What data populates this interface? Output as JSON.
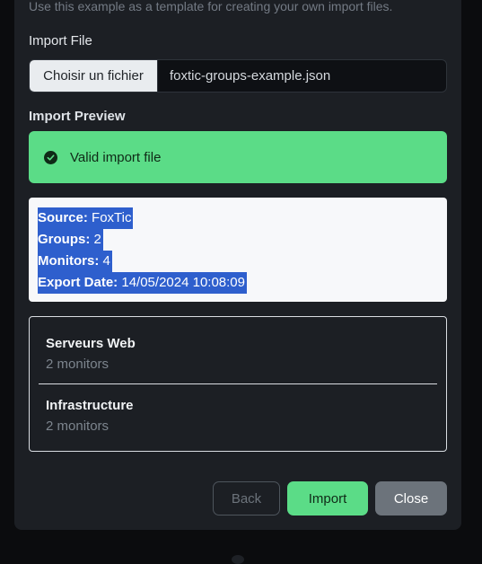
{
  "hint_text": "Use this example as a template for creating your own import files.",
  "import_file": {
    "label": "Import File",
    "button_label": "Choisir un fichier",
    "file_name": "foxtic-groups-example.json"
  },
  "import_preview": {
    "label": "Import Preview",
    "alert_text": "Valid import file",
    "alert_icon": "check-circle-icon",
    "summary": [
      {
        "key": "Source:",
        "value": "FoxTic"
      },
      {
        "key": "Groups:",
        "value": "2"
      },
      {
        "key": "Monitors:",
        "value": "4"
      },
      {
        "key": "Export Date:",
        "value": "14/05/2024 10:08:09"
      }
    ],
    "groups": [
      {
        "name": "Serveurs Web",
        "count": "2 monitors"
      },
      {
        "name": "Infrastructure",
        "count": "2 monitors"
      }
    ]
  },
  "footer": {
    "back_label": "Back",
    "import_label": "Import",
    "close_label": "Close"
  },
  "colors": {
    "success": "#5bdc87",
    "selection": "#2e5fcd",
    "modal_bg": "#1c1f24"
  }
}
